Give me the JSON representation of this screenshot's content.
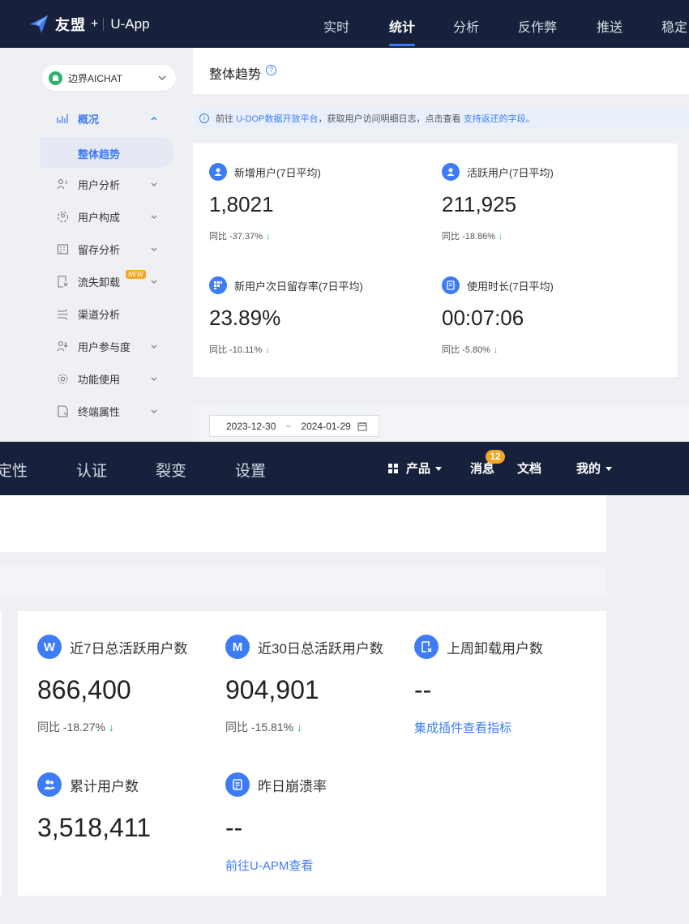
{
  "brand": {
    "name": "友盟",
    "plus": "+",
    "app": "U-App"
  },
  "nav": {
    "items": [
      "实时",
      "统计",
      "分析",
      "反作弊",
      "推送",
      "稳定"
    ],
    "active": "统计"
  },
  "sidebar": {
    "app_select": "边界AICHAT",
    "overview": "概况",
    "active_sub": "整体趋势",
    "items": [
      "用户分析",
      "用户构成",
      "留存分析",
      "流失卸载",
      "渠道分析",
      "用户参与度",
      "功能使用",
      "终端属性"
    ],
    "new_badge": "NEW"
  },
  "main": {
    "title": "整体趋势",
    "notice": {
      "prefix": "前往",
      "link1": "U-DOP数据开放平台",
      "middle": "，获取用户访问明细日志，点击查看",
      "link2": "支持返还的字段。"
    },
    "stats": [
      {
        "label": "新增用户(7日平均)",
        "value": "1,8021",
        "compare": "同比 -37.37%"
      },
      {
        "label": "活跃用户(7日平均)",
        "value": "211,925",
        "compare": "同比 -18.86%"
      },
      {
        "label": "新用户次日留存率(7日平均)",
        "value": "23.89%",
        "compare": "同比 -10.11%"
      },
      {
        "label": "使用时长(7日平均)",
        "value": "00:07:06",
        "compare": "同比 -5.80%"
      }
    ],
    "date_range": {
      "start": "2023-12-30",
      "sep": "~",
      "end": "2024-01-29"
    }
  },
  "nav2": {
    "items": [
      "定性",
      "认证",
      "裂变",
      "设置"
    ],
    "product": "产品",
    "messages": "消息",
    "message_count": "12",
    "docs": "文档",
    "mine": "我的"
  },
  "lower": {
    "stats": [
      {
        "icon_letter": "W",
        "label": "近7日总活跃用户数",
        "value": "866,400",
        "compare": "同比 -18.27%"
      },
      {
        "icon_letter": "M",
        "label": "近30日总活跃用户数",
        "value": "904,901",
        "compare": "同比 -15.81%"
      },
      {
        "label": "上周卸载用户数",
        "value": "--",
        "link": "集成插件查看指标"
      },
      {
        "label": "累计用户数",
        "value": "3,518,411"
      },
      {
        "label": "昨日崩溃率",
        "value": "--",
        "link": "前往U-APM查看"
      }
    ]
  },
  "colors": {
    "nav_bg": "#17213b",
    "accent": "#3d7cf5",
    "down": "#2fb36b",
    "badge": "#f5a623"
  }
}
